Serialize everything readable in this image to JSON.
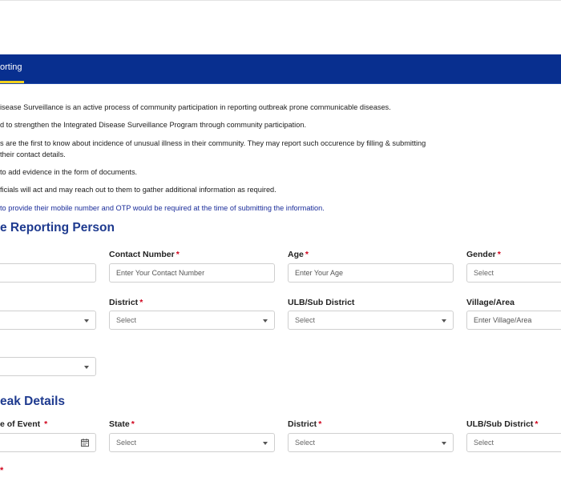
{
  "nav": {
    "tab_label": "orting"
  },
  "info": {
    "lines": [
      "isease Surveillance is an active process of community participation in reporting outbreak prone communicable diseases.",
      "d to strengthen the Integrated Disease Surveillance Program through community participation.",
      "s are the first to know about incidence of unusual illness in their community. They may report such occurence by filling & submitting",
      "their contact details.",
      "to add evidence in the form of documents.",
      "ficials will act and may reach out to them to gather additional information as required.",
      "to provide their mobile number and OTP would be required at the time of submitting the information."
    ]
  },
  "reporting_section": {
    "title": "e Reporting Person",
    "contact_label": "Contact Number",
    "contact_placeholder": "Enter Your Contact Number",
    "age_label": "Age",
    "age_placeholder": "Enter Your Age",
    "gender_label": "Gender",
    "gender_value": "Select",
    "district_label": "District",
    "district_value": "Select",
    "ulb_label": "ULB/Sub District",
    "ulb_value": "Select",
    "village_label": "Village/Area",
    "village_placeholder": "Enter Village/Area",
    "required_mark": "*"
  },
  "outbreak_section": {
    "title": "eak Details",
    "date_label": "e of Event",
    "state_label": "State",
    "state_value": "Select",
    "district_label": "District",
    "district_value": "Select",
    "ulb_label": "ULB/Sub District",
    "ulb_value": "Select",
    "required_mark": "*"
  },
  "colors": {
    "navbar": "#082f8f",
    "accent": "#f2d11d",
    "heading": "#1e3a8f",
    "required": "#d0021b"
  }
}
